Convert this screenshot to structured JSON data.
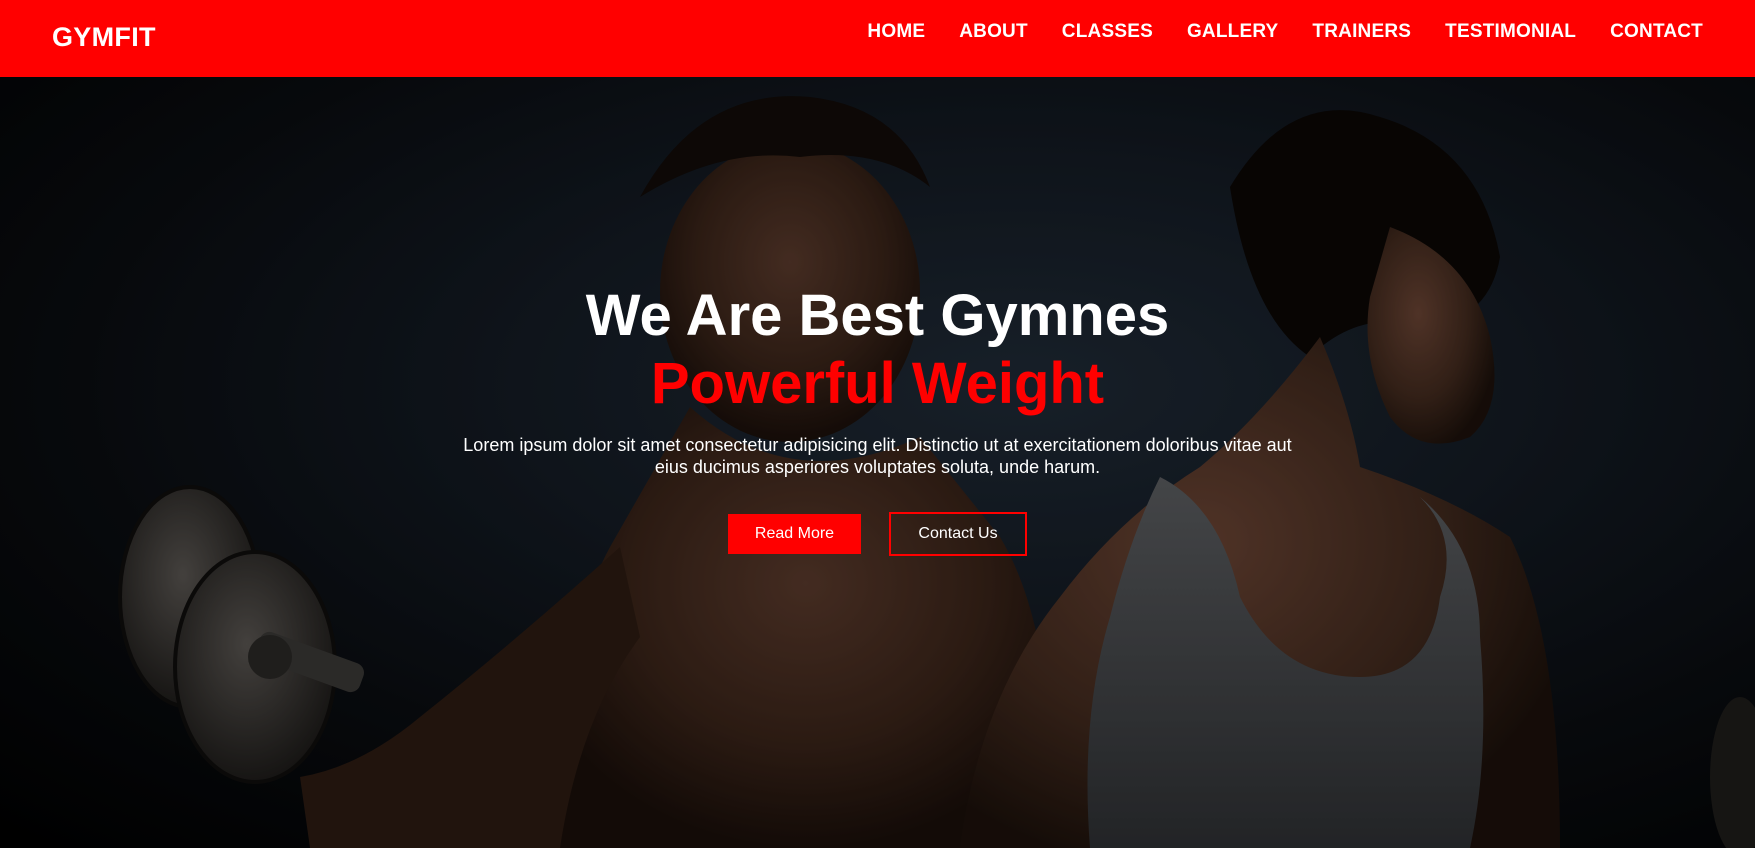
{
  "navbar": {
    "logo": "GYMFIT",
    "links": [
      "HOME",
      "ABOUT",
      "CLASSES",
      "GALLERY",
      "TRAINERS",
      "TESTIMONIAL",
      "CONTACT"
    ]
  },
  "hero": {
    "title": "We Are Best Gymnes",
    "subtitle": "Powerful Weight",
    "text": "Lorem ipsum dolor sit amet consectetur adipisicing elit. Distinctio ut at exercitationem doloribus vitae aut eius ducimus asperiores voluptates soluta, unde harum.",
    "read_more": "Read More",
    "contact_us": "Contact Us"
  },
  "colors": {
    "brand": "#ff0000",
    "text": "#ffffff",
    "background": "#000000"
  }
}
